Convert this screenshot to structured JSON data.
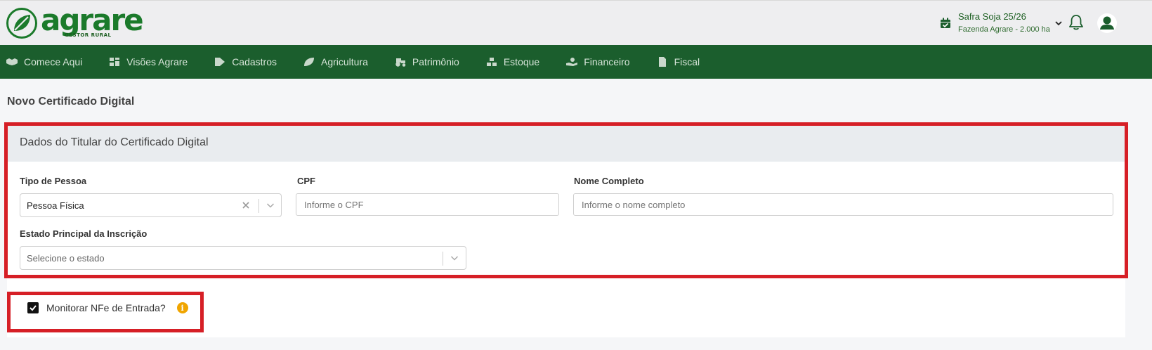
{
  "header": {
    "logo_text": "agrare",
    "logo_sub": "GESTOR RURAL",
    "safra_name": "Safra Soja 25/26",
    "farm": "Fazenda Agrare - 2.000 ha"
  },
  "nav": {
    "items": [
      {
        "label": "Comece Aqui",
        "icon": "handshake-icon"
      },
      {
        "label": "Visões Agrare",
        "icon": "dashboard-icon"
      },
      {
        "label": "Cadastros",
        "icon": "tag-icon"
      },
      {
        "label": "Agricultura",
        "icon": "leaf-icon"
      },
      {
        "label": "Patrimônio",
        "icon": "tractor-icon"
      },
      {
        "label": "Estoque",
        "icon": "boxes-icon"
      },
      {
        "label": "Financeiro",
        "icon": "money-hand-icon"
      },
      {
        "label": "Fiscal",
        "icon": "invoice-icon"
      }
    ]
  },
  "page": {
    "title": "Novo Certificado Digital"
  },
  "form": {
    "section_title": "Dados do Titular do Certificado Digital",
    "tipo_pessoa": {
      "label": "Tipo de Pessoa",
      "value": "Pessoa Física"
    },
    "cpf": {
      "label": "CPF",
      "placeholder": "Informe o CPF"
    },
    "nome": {
      "label": "Nome Completo",
      "placeholder": "Informe o nome completo"
    },
    "estado": {
      "label": "Estado Principal da Inscrição",
      "placeholder": "Selecione o estado"
    },
    "monitorar": {
      "label": "Monitorar NFe de Entrada?",
      "checked": true
    }
  },
  "colors": {
    "brand_green": "#1b5e2d",
    "highlight_red": "#d61f26",
    "info_orange": "#f0a500"
  }
}
